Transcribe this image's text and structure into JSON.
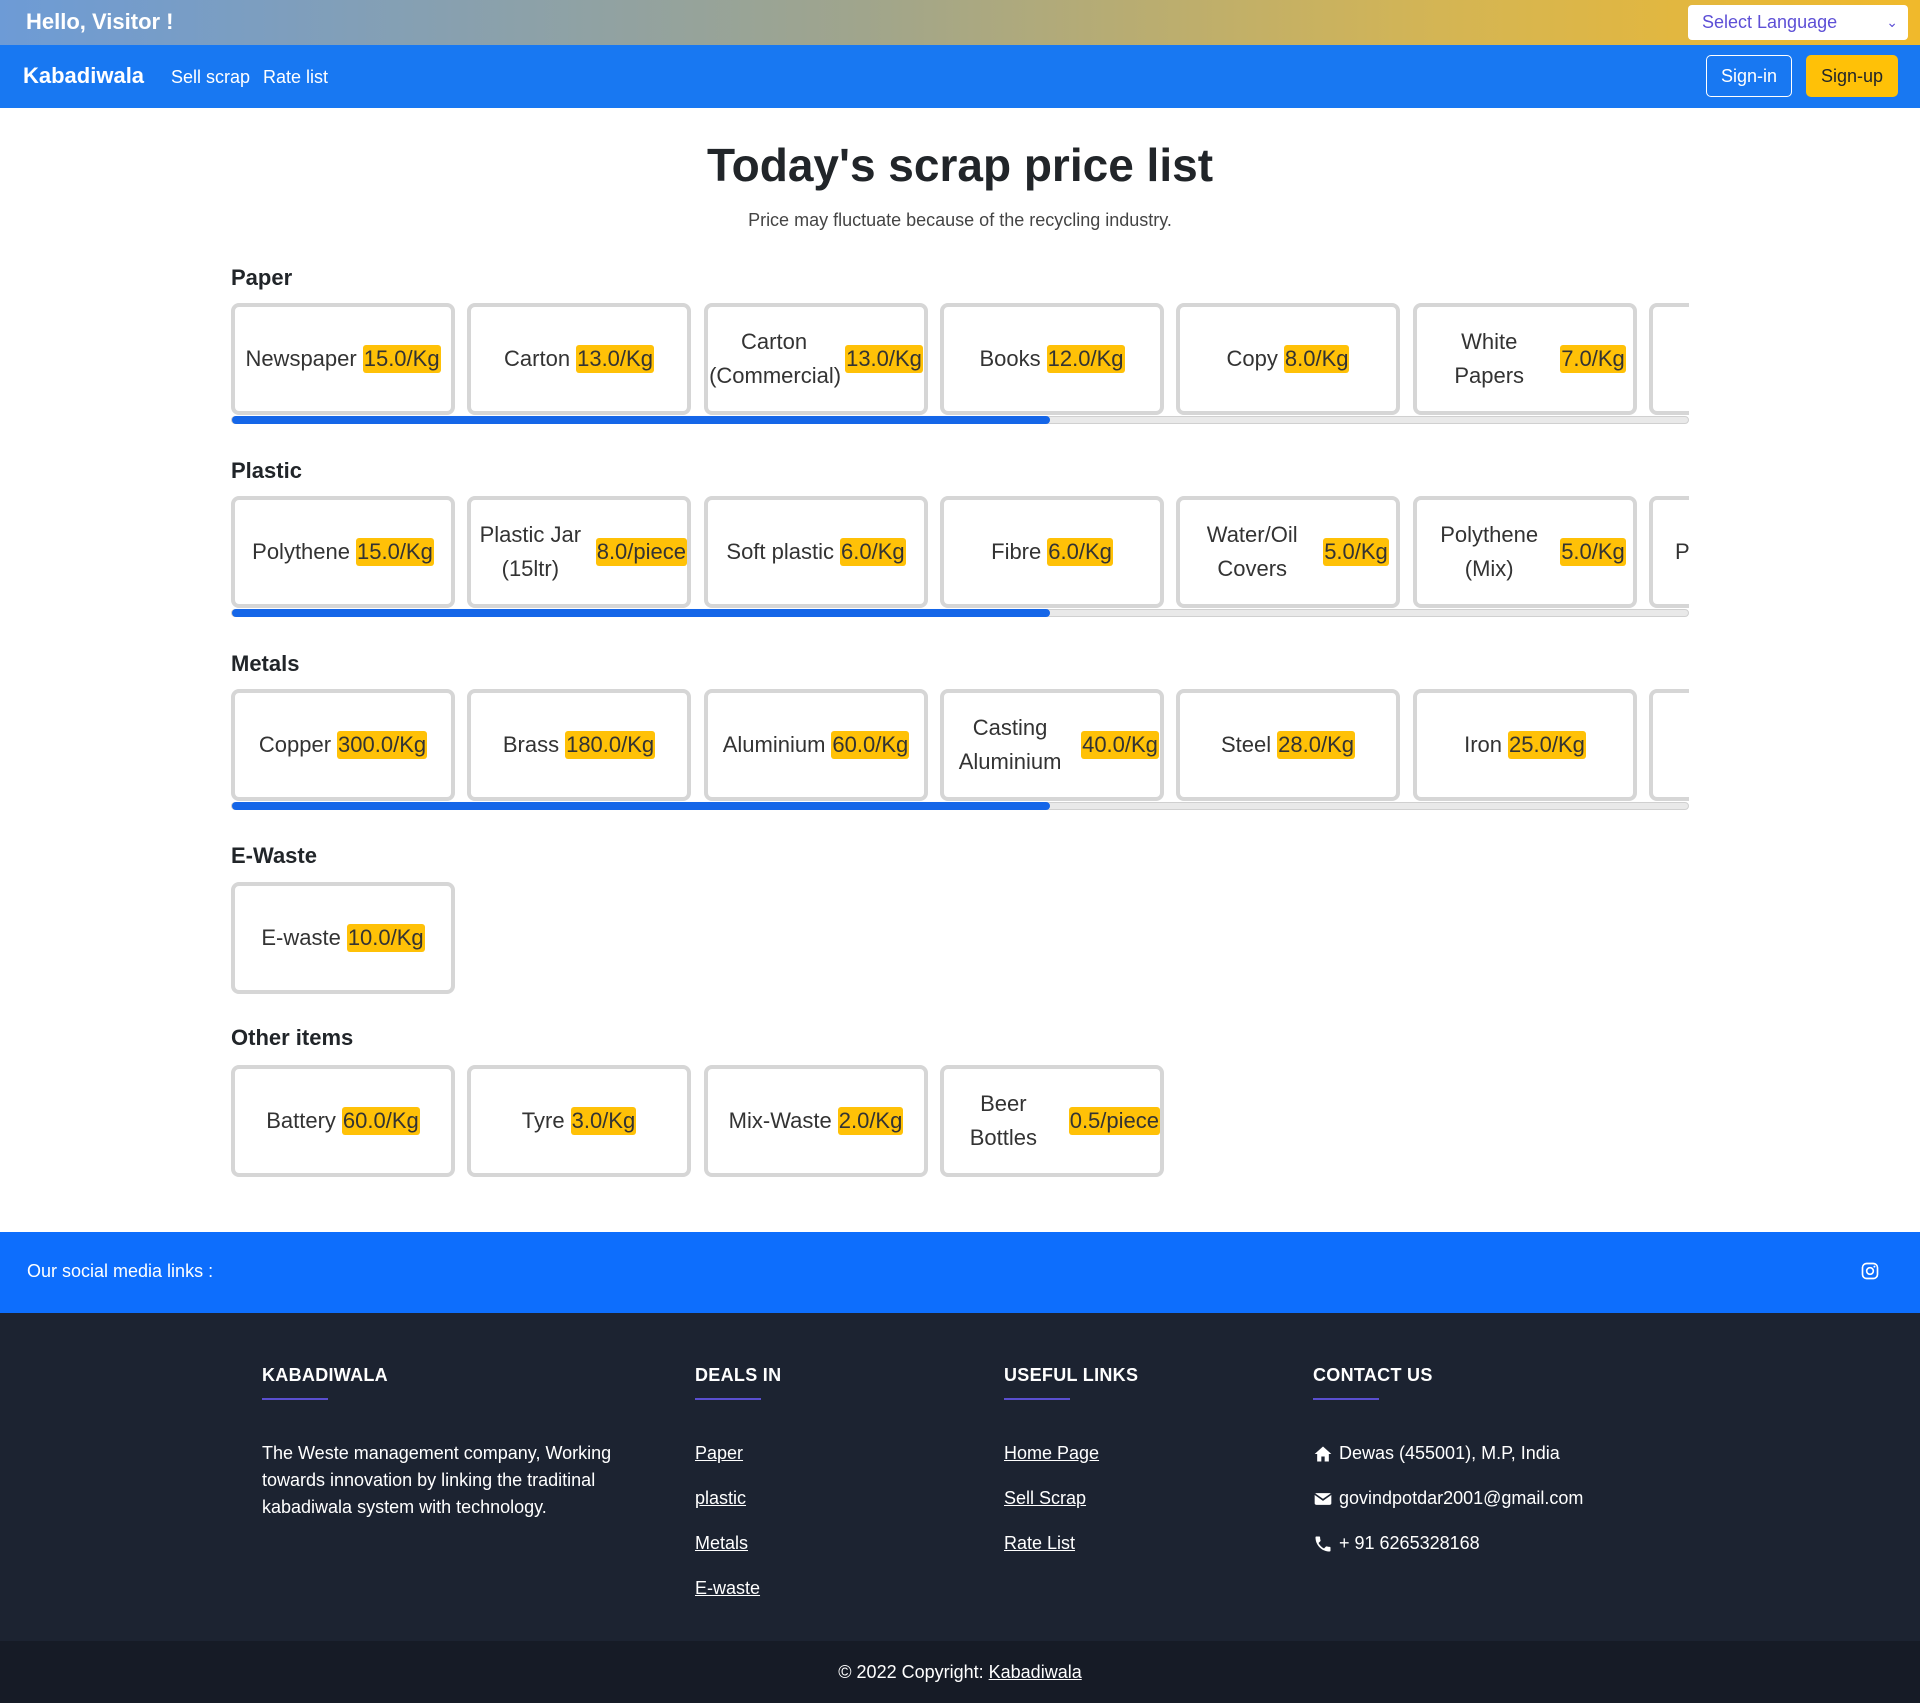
{
  "topbar": {
    "greeting": "Hello, Visitor !",
    "language_select": "Select Language"
  },
  "nav": {
    "brand": "Kabadiwala",
    "links": [
      "Sell scrap",
      "Rate list"
    ],
    "signin": "Sign-in",
    "signup": "Sign-up"
  },
  "page": {
    "title": "Today's scrap price list",
    "subtitle": "Price may fluctuate because of the recycling industry."
  },
  "sections": [
    {
      "title": "Paper",
      "items": [
        {
          "name": "Newspaper",
          "price": "15.0/Kg"
        },
        {
          "name": "Carton",
          "price": "13.0/Kg"
        },
        {
          "name": "Carton (Commercial)",
          "price": "13.0/Kg"
        },
        {
          "name": "Books",
          "price": "12.0/Kg"
        },
        {
          "name": "Copy",
          "price": "8.0/Kg"
        },
        {
          "name": "White Papers",
          "price": "7.0/Kg"
        }
      ],
      "partial": "",
      "scrollbar": true
    },
    {
      "title": "Plastic",
      "items": [
        {
          "name": "Polythene",
          "price": "15.0/Kg"
        },
        {
          "name": "Plastic Jar (15ltr)",
          "price": "8.0/piece"
        },
        {
          "name": "Soft plastic",
          "price": "6.0/Kg"
        },
        {
          "name": "Fibre",
          "price": "6.0/Kg"
        },
        {
          "name": "Water/Oil Covers",
          "price": "5.0/Kg"
        },
        {
          "name": "Polythene (Mix)",
          "price": "5.0/Kg"
        }
      ],
      "partial": "P",
      "scrollbar": true
    },
    {
      "title": "Metals",
      "items": [
        {
          "name": "Copper",
          "price": "300.0/Kg"
        },
        {
          "name": "Brass",
          "price": "180.0/Kg"
        },
        {
          "name": "Aluminium",
          "price": "60.0/Kg"
        },
        {
          "name": "Casting Aluminium",
          "price": "40.0/Kg"
        },
        {
          "name": "Steel",
          "price": "28.0/Kg"
        },
        {
          "name": "Iron",
          "price": "25.0/Kg"
        }
      ],
      "partial": "",
      "scrollbar": true
    },
    {
      "title": "E-Waste",
      "items": [
        {
          "name": "E-waste",
          "price": "10.0/Kg"
        }
      ],
      "scrollbar": false
    },
    {
      "title": "Other items",
      "items": [
        {
          "name": "Battery",
          "price": "60.0/Kg"
        },
        {
          "name": "Tyre",
          "price": "3.0/Kg"
        },
        {
          "name": "Mix-Waste",
          "price": "2.0/Kg"
        },
        {
          "name": "Beer Bottles",
          "price": "0.5/piece"
        }
      ],
      "scrollbar": false
    }
  ],
  "social": {
    "label": "Our social media links :",
    "icon": "instagram-icon"
  },
  "footer": {
    "about": {
      "heading": "KABADIWALA",
      "text": "The Weste management company, Working towards innovation by linking the traditinal kabadiwala system with technology."
    },
    "deals": {
      "heading": "DEALS IN",
      "links": [
        "Paper",
        "plastic",
        "Metals",
        "E-waste"
      ]
    },
    "useful": {
      "heading": "USEFUL LINKS",
      "links": [
        "Home Page",
        "Sell Scrap",
        "Rate List"
      ]
    },
    "contact": {
      "heading": "CONTACT US",
      "address": "Dewas (455001), M.P, India",
      "email": "govindpotdar2001@gmail.com",
      "phone": "+ 91 6265328168"
    },
    "copyright_prefix": "© 2022 Copyright: ",
    "copyright_link": "Kabadiwala"
  },
  "colors": {
    "primary": "#1878f2",
    "accent": "#ffc107",
    "footer": "#1c2331"
  }
}
